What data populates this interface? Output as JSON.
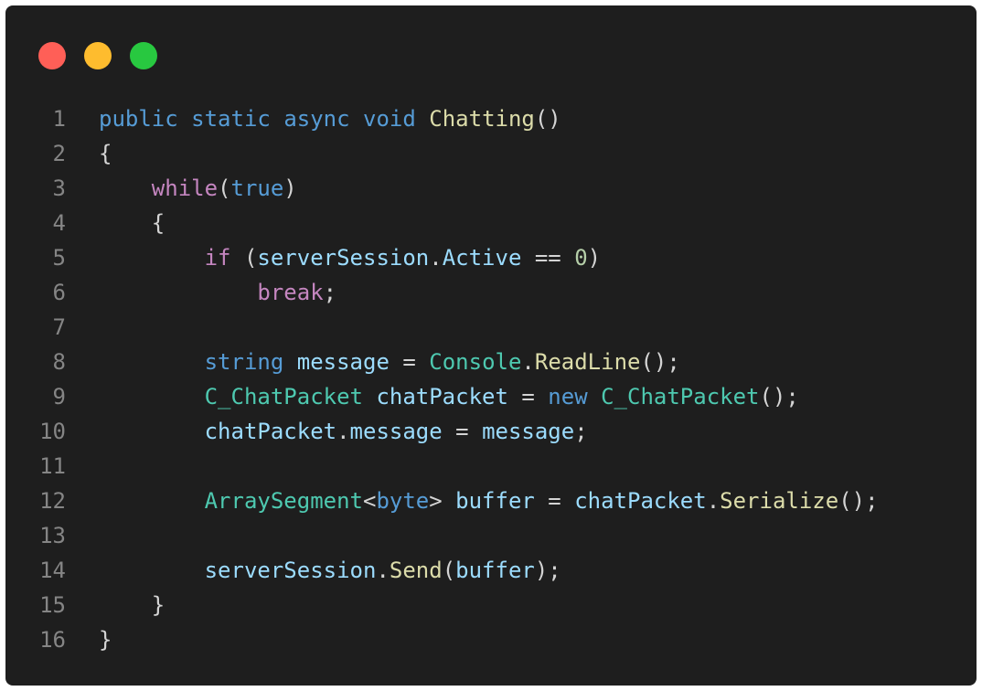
{
  "window": {
    "controls": [
      {
        "name": "close",
        "color": "#ff5f57"
      },
      {
        "name": "minimize",
        "color": "#febc2e"
      },
      {
        "name": "maximize",
        "color": "#28c840"
      }
    ]
  },
  "code": {
    "language": "csharp",
    "lines": [
      {
        "n": "1",
        "tokens": [
          [
            "kw",
            "public"
          ],
          [
            "pun",
            " "
          ],
          [
            "kw",
            "static"
          ],
          [
            "pun",
            " "
          ],
          [
            "kw",
            "async"
          ],
          [
            "pun",
            " "
          ],
          [
            "kw",
            "void"
          ],
          [
            "pun",
            " "
          ],
          [
            "fn",
            "Chatting"
          ],
          [
            "pun",
            "()"
          ]
        ]
      },
      {
        "n": "2",
        "tokens": [
          [
            "pun",
            "{"
          ]
        ]
      },
      {
        "n": "3",
        "tokens": [
          [
            "pun",
            "    "
          ],
          [
            "ctl",
            "while"
          ],
          [
            "pun",
            "("
          ],
          [
            "kw",
            "true"
          ],
          [
            "pun",
            ")"
          ]
        ]
      },
      {
        "n": "4",
        "tokens": [
          [
            "pun",
            "    {"
          ]
        ]
      },
      {
        "n": "5",
        "tokens": [
          [
            "pun",
            "        "
          ],
          [
            "ctl",
            "if"
          ],
          [
            "pun",
            " ("
          ],
          [
            "var",
            "serverSession"
          ],
          [
            "pun",
            "."
          ],
          [
            "var",
            "Active"
          ],
          [
            "pun",
            " == "
          ],
          [
            "num",
            "0"
          ],
          [
            "pun",
            ")"
          ]
        ]
      },
      {
        "n": "6",
        "tokens": [
          [
            "pun",
            "            "
          ],
          [
            "ctl",
            "break"
          ],
          [
            "pun",
            ";"
          ]
        ]
      },
      {
        "n": "7",
        "tokens": []
      },
      {
        "n": "8",
        "tokens": [
          [
            "pun",
            "        "
          ],
          [
            "kw",
            "string"
          ],
          [
            "pun",
            " "
          ],
          [
            "var",
            "message"
          ],
          [
            "pun",
            " = "
          ],
          [
            "ty",
            "Console"
          ],
          [
            "pun",
            "."
          ],
          [
            "fn",
            "ReadLine"
          ],
          [
            "pun",
            "();"
          ]
        ]
      },
      {
        "n": "9",
        "tokens": [
          [
            "pun",
            "        "
          ],
          [
            "ty",
            "C_ChatPacket"
          ],
          [
            "pun",
            " "
          ],
          [
            "var",
            "chatPacket"
          ],
          [
            "pun",
            " = "
          ],
          [
            "kw",
            "new"
          ],
          [
            "pun",
            " "
          ],
          [
            "ty",
            "C_ChatPacket"
          ],
          [
            "pun",
            "();"
          ]
        ]
      },
      {
        "n": "10",
        "tokens": [
          [
            "pun",
            "        "
          ],
          [
            "var",
            "chatPacket"
          ],
          [
            "pun",
            "."
          ],
          [
            "var",
            "message"
          ],
          [
            "pun",
            " = "
          ],
          [
            "var",
            "message"
          ],
          [
            "pun",
            ";"
          ]
        ]
      },
      {
        "n": "11",
        "tokens": []
      },
      {
        "n": "12",
        "tokens": [
          [
            "pun",
            "        "
          ],
          [
            "ty",
            "ArraySegment"
          ],
          [
            "pun",
            "<"
          ],
          [
            "kw",
            "byte"
          ],
          [
            "pun",
            "> "
          ],
          [
            "var",
            "buffer"
          ],
          [
            "pun",
            " = "
          ],
          [
            "var",
            "chatPacket"
          ],
          [
            "pun",
            "."
          ],
          [
            "fn",
            "Serialize"
          ],
          [
            "pun",
            "();"
          ]
        ]
      },
      {
        "n": "13",
        "tokens": []
      },
      {
        "n": "14",
        "tokens": [
          [
            "pun",
            "        "
          ],
          [
            "var",
            "serverSession"
          ],
          [
            "pun",
            "."
          ],
          [
            "fn",
            "Send"
          ],
          [
            "pun",
            "("
          ],
          [
            "var",
            "buffer"
          ],
          [
            "pun",
            ");"
          ]
        ]
      },
      {
        "n": "15",
        "tokens": [
          [
            "pun",
            "    }"
          ]
        ]
      },
      {
        "n": "16",
        "tokens": [
          [
            "pun",
            "}"
          ]
        ]
      }
    ]
  }
}
